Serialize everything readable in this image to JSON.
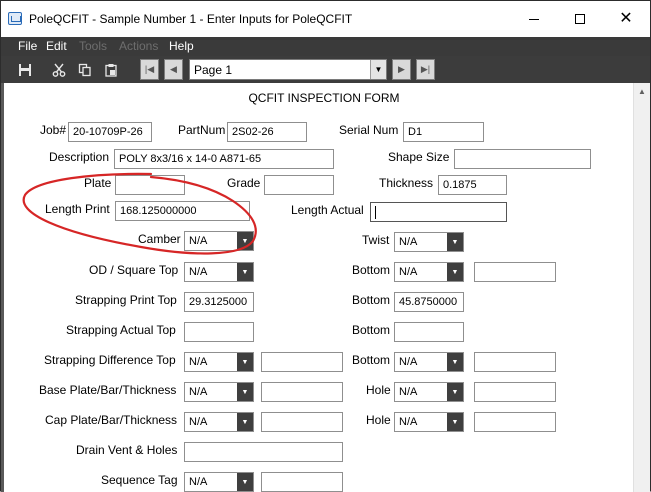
{
  "window": {
    "title": "PoleQCFIT - Sample Number 1 - Enter Inputs for PoleQCFIT",
    "minimize_icon": "minimize-icon",
    "maximize_icon": "maximize-icon",
    "close_glyph": "✕"
  },
  "menu": {
    "file": "File",
    "edit": "Edit",
    "tools": "Tools",
    "actions": "Actions",
    "help": "Help"
  },
  "toolbar": {
    "save": "save-icon",
    "cut": "scissors-icon",
    "copy": "copy-icon",
    "paste": "clipboard-icon",
    "page": "Page 1"
  },
  "form": {
    "title": "QCFIT INSPECTION FORM",
    "job_label": "Job#",
    "job_value": "20-10709P-26",
    "partnum_label": "PartNum",
    "partnum_value": "2S02-26",
    "serial_label": "Serial Num",
    "serial_value": "D1",
    "description_label": "Description",
    "description_value": "POLY 8x3/16 x 14-0 A871-65",
    "shape_size_label": "Shape Size",
    "shape_size_value": "",
    "plate_label": "Plate",
    "plate_value": "",
    "grade_label": "Grade",
    "grade_value": "",
    "thickness_label": "Thickness",
    "thickness_value": "0.1875",
    "length_print_label": "Length Print",
    "length_print_value": "168.125000000",
    "length_actual_label": "Length Actual",
    "length_actual_value": "",
    "camber_label": "Camber",
    "camber_value": "N/A",
    "twist_label": "Twist",
    "twist_value": "N/A",
    "od_top_label": "OD / Square Top",
    "od_top_value": "N/A",
    "od_bottom_label": "Bottom",
    "od_bottom_select": "N/A",
    "od_bottom_value": "",
    "strap_print_top_label": "Strapping Print Top",
    "strap_print_top_value": "29.3125000",
    "strap_print_bottom_label": "Bottom",
    "strap_print_bottom_value": "45.8750000",
    "strap_actual_top_label": "Strapping Actual Top",
    "strap_actual_top_value": "",
    "strap_actual_bottom_label": "Bottom",
    "strap_actual_bottom_value": "",
    "strap_diff_top_label": "Strapping Difference Top",
    "strap_diff_top_select": "N/A",
    "strap_diff_top_value": "",
    "strap_diff_bottom_label": "Bottom",
    "strap_diff_bottom_select": "N/A",
    "strap_diff_bottom_value": "",
    "base_plate_label": "Base Plate/Bar/Thickness",
    "base_plate_select": "N/A",
    "base_plate_value": "",
    "base_hole_label": "Hole",
    "base_hole_select": "N/A",
    "base_hole_value": "",
    "cap_plate_label": "Cap Plate/Bar/Thickness",
    "cap_plate_select": "N/A",
    "cap_plate_value": "",
    "cap_hole_label": "Hole",
    "cap_hole_select": "N/A",
    "cap_hole_value": "",
    "drain_label": "Drain Vent & Holes",
    "drain_value": "",
    "sequence_label": "Sequence Tag",
    "sequence_select": "N/A",
    "sequence_value": ""
  },
  "colors": {
    "menu_bg": "#3a3a3a",
    "annotation": "#d62626"
  }
}
